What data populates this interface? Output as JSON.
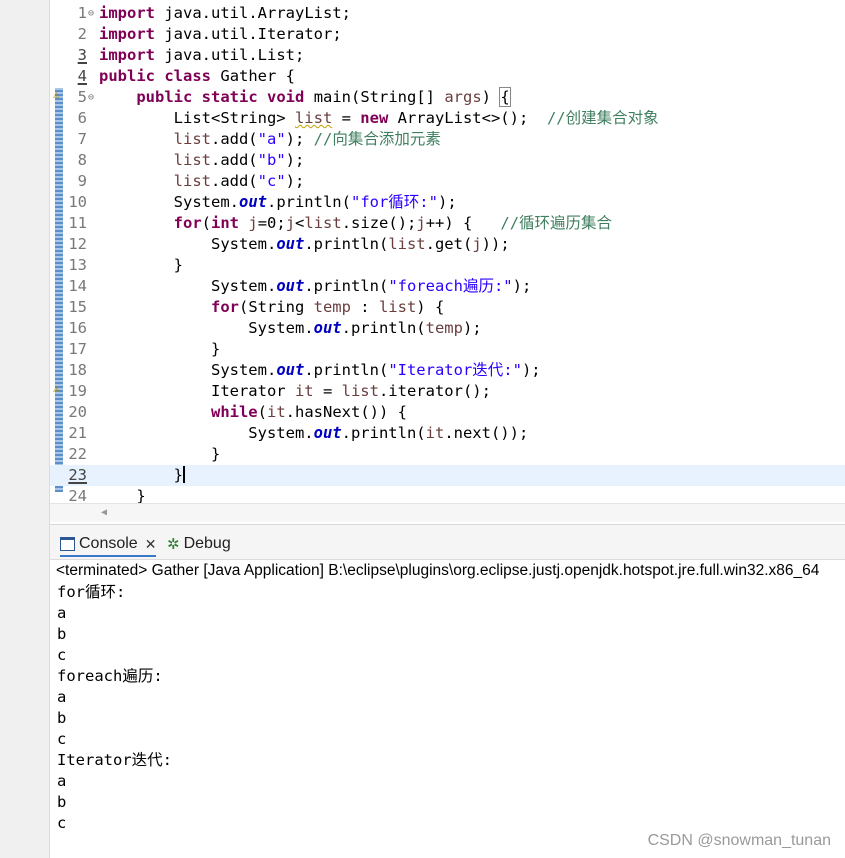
{
  "editor": {
    "lines": [
      {
        "n": "1",
        "fold": "⊖",
        "segs": [
          [
            "kw",
            "import"
          ],
          [
            "",
            "java.util.ArrayList;"
          ]
        ]
      },
      {
        "n": "2",
        "segs": [
          [
            "kw",
            "import"
          ],
          [
            "",
            "java.util.Iterator;"
          ]
        ]
      },
      {
        "n": "3",
        "ul": true,
        "segs": [
          [
            "kw",
            "import"
          ],
          [
            "",
            "java.util.List;"
          ]
        ]
      },
      {
        "n": "4",
        "ul": true,
        "segs": [
          [
            "kw",
            "public"
          ],
          [
            "",
            ""
          ],
          [
            "kw",
            "class"
          ],
          [
            "",
            "Gather {"
          ]
        ]
      },
      {
        "n": "5",
        "fold": "⊖",
        "warn": "⚠",
        "segs": [
          [
            "",
            "    "
          ],
          [
            "kw",
            "public"
          ],
          [
            "",
            ""
          ],
          [
            "kw",
            "static"
          ],
          [
            "",
            ""
          ],
          [
            "kw",
            "void"
          ],
          [
            "",
            "main(String[] "
          ],
          [
            "var",
            "args"
          ],
          [
            "",
            ") "
          ],
          [
            "bracket",
            "{"
          ]
        ]
      },
      {
        "n": "6",
        "segs": [
          [
            "",
            "        List<String> "
          ],
          [
            "warnvar",
            "list"
          ],
          [
            "",
            " = "
          ],
          [
            "kw",
            "new"
          ],
          [
            "",
            " ArrayList<>();  "
          ],
          [
            "cm",
            "//创建集合对象"
          ]
        ]
      },
      {
        "n": "7",
        "segs": [
          [
            "",
            "        "
          ],
          [
            "var",
            "list"
          ],
          [
            "",
            ".add("
          ],
          [
            "str",
            "\"a\""
          ],
          [
            "",
            "); "
          ],
          [
            "cm",
            "//向集合添加元素"
          ]
        ]
      },
      {
        "n": "8",
        "segs": [
          [
            "",
            "        "
          ],
          [
            "var",
            "list"
          ],
          [
            "",
            ".add("
          ],
          [
            "str",
            "\"b\""
          ],
          [
            "",
            ");"
          ]
        ]
      },
      {
        "n": "9",
        "segs": [
          [
            "",
            "        "
          ],
          [
            "var",
            "list"
          ],
          [
            "",
            ".add("
          ],
          [
            "str",
            "\"c\""
          ],
          [
            "",
            ");"
          ]
        ]
      },
      {
        "n": "10",
        "segs": [
          [
            "",
            "        System."
          ],
          [
            "fld",
            "out"
          ],
          [
            "",
            ".println("
          ],
          [
            "str",
            "\"for循环:\""
          ],
          [
            "",
            ");"
          ]
        ]
      },
      {
        "n": "11",
        "segs": [
          [
            "",
            "        "
          ],
          [
            "kw",
            "for"
          ],
          [
            "",
            "("
          ],
          [
            "kw",
            "int"
          ],
          [
            "",
            " "
          ],
          [
            "var",
            "j"
          ],
          [
            "",
            "=0;"
          ],
          [
            "var",
            "j"
          ],
          [
            "",
            "<"
          ],
          [
            "var",
            "list"
          ],
          [
            "",
            ".size();"
          ],
          [
            "var",
            "j"
          ],
          [
            "",
            "++) {   "
          ],
          [
            "cm",
            "//循环遍历集合"
          ]
        ]
      },
      {
        "n": "12",
        "segs": [
          [
            "",
            "            System."
          ],
          [
            "fld",
            "out"
          ],
          [
            "",
            ".println("
          ],
          [
            "var",
            "list"
          ],
          [
            "",
            ".get("
          ],
          [
            "var",
            "j"
          ],
          [
            "",
            "));"
          ]
        ]
      },
      {
        "n": "13",
        "segs": [
          [
            "",
            "        }"
          ]
        ]
      },
      {
        "n": "14",
        "segs": [
          [
            "",
            "            System."
          ],
          [
            "fld",
            "out"
          ],
          [
            "",
            ".println("
          ],
          [
            "str",
            "\"foreach遍历:\""
          ],
          [
            "",
            ");"
          ]
        ]
      },
      {
        "n": "15",
        "segs": [
          [
            "",
            "            "
          ],
          [
            "kw",
            "for"
          ],
          [
            "",
            "(String "
          ],
          [
            "var",
            "temp"
          ],
          [
            "",
            " : "
          ],
          [
            "var",
            "list"
          ],
          [
            "",
            ") {"
          ]
        ]
      },
      {
        "n": "16",
        "segs": [
          [
            "",
            "                System."
          ],
          [
            "fld",
            "out"
          ],
          [
            "",
            ".println("
          ],
          [
            "var",
            "temp"
          ],
          [
            "",
            ");"
          ]
        ]
      },
      {
        "n": "17",
        "segs": [
          [
            "",
            "            }"
          ]
        ]
      },
      {
        "n": "18",
        "segs": [
          [
            "",
            "            System."
          ],
          [
            "fld",
            "out"
          ],
          [
            "",
            ".println("
          ],
          [
            "str",
            "\"Iterator迭代:\""
          ],
          [
            "",
            ");"
          ]
        ]
      },
      {
        "n": "19",
        "warn": "⚠",
        "segs": [
          [
            "",
            "            Iterator "
          ],
          [
            "var",
            "it"
          ],
          [
            "",
            " = "
          ],
          [
            "var",
            "list"
          ],
          [
            "",
            ".iterator();"
          ]
        ]
      },
      {
        "n": "20",
        "segs": [
          [
            "",
            "            "
          ],
          [
            "kw",
            "while"
          ],
          [
            "",
            "("
          ],
          [
            "var",
            "it"
          ],
          [
            "",
            ".hasNext()) {"
          ]
        ]
      },
      {
        "n": "21",
        "segs": [
          [
            "",
            "                System."
          ],
          [
            "fld",
            "out"
          ],
          [
            "",
            ".println("
          ],
          [
            "var",
            "it"
          ],
          [
            "",
            ".next());"
          ]
        ]
      },
      {
        "n": "22",
        "segs": [
          [
            "",
            "            }"
          ]
        ]
      },
      {
        "n": "23",
        "ul": true,
        "current": true,
        "segs": [
          [
            "",
            "        }"
          ],
          [
            "caret",
            ""
          ]
        ]
      },
      {
        "n": "24",
        "segs": [
          [
            "",
            "    }"
          ]
        ]
      }
    ]
  },
  "panel": {
    "console_tab": "Console",
    "debug_tab": "Debug",
    "status": "<terminated> Gather [Java Application] B:\\eclipse\\plugins\\org.eclipse.justj.openjdk.hotspot.jre.full.win32.x86_64"
  },
  "console_output": [
    "for循环:",
    "a",
    "b",
    "c",
    "foreach遍历:",
    "a",
    "b",
    "c",
    "Iterator迭代:",
    "a",
    "b",
    "c"
  ],
  "watermark": "CSDN @snowman_tunan"
}
